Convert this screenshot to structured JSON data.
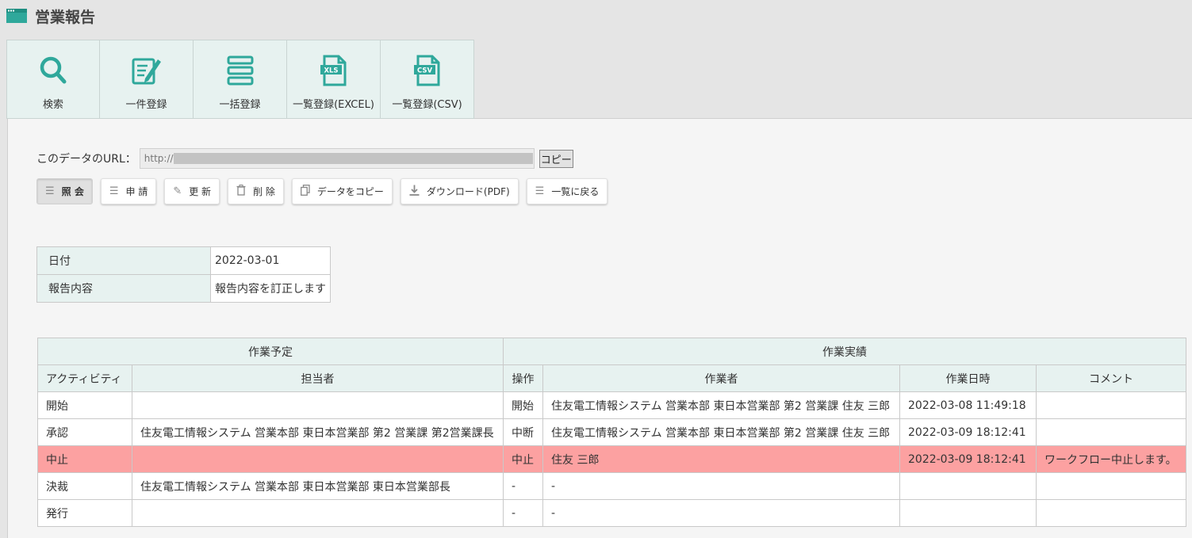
{
  "page": {
    "title": "営業報告"
  },
  "toolbar": {
    "search": "検索",
    "single": "一件登録",
    "bulk": "一括登録",
    "excel": "一覧登録(EXCEL)",
    "csv": "一覧登録(CSV)",
    "xls_badge": "XLS",
    "csv_badge": "CSV"
  },
  "url_row": {
    "label": "このデータのURL：",
    "prefix": "http://",
    "copy": "コピー"
  },
  "actions": {
    "view": "照 会",
    "apply": "申 請",
    "update": "更 新",
    "delete": "削 除",
    "copy_data": "データをコピー",
    "download": "ダウンロード(PDF)",
    "back": "一覧に戻る"
  },
  "record": {
    "date_label": "日付",
    "date_value": "2022-03-01",
    "content_label": "報告内容",
    "content_value": "報告内容を訂正します"
  },
  "workflow": {
    "group_plan": "作業予定",
    "group_actual": "作業実績",
    "headers": [
      "アクティビティ",
      "担当者",
      "操作",
      "作業者",
      "作業日時",
      "コメント"
    ],
    "rows": [
      [
        "開始",
        "",
        "開始",
        "住友電工情報システム 営業本部 東日本営業部 第2 営業課 住友 三郎",
        "2022-03-08 11:49:18",
        ""
      ],
      [
        "承認",
        "住友電工情報システム 営業本部 東日本営業部 第2 営業課 第2営業課長",
        "中断",
        "住友電工情報システム 営業本部 東日本営業部 第2 営業課 住友 三郎",
        "2022-03-09 18:12:41",
        ""
      ],
      [
        "中止",
        "",
        "中止",
        "住友 三郎",
        "2022-03-09 18:12:41",
        "ワークフロー中止します。"
      ],
      [
        "決裁",
        "住友電工情報システム 営業本部 東日本営業部 東日本営業部長",
        "-",
        "-",
        "",
        ""
      ],
      [
        "発行",
        "",
        "-",
        "-",
        "",
        ""
      ]
    ],
    "highlight_color": "#fca1a1"
  },
  "colors": {
    "accent": "#2fa89b",
    "header_bg": "#e7f2f0"
  }
}
